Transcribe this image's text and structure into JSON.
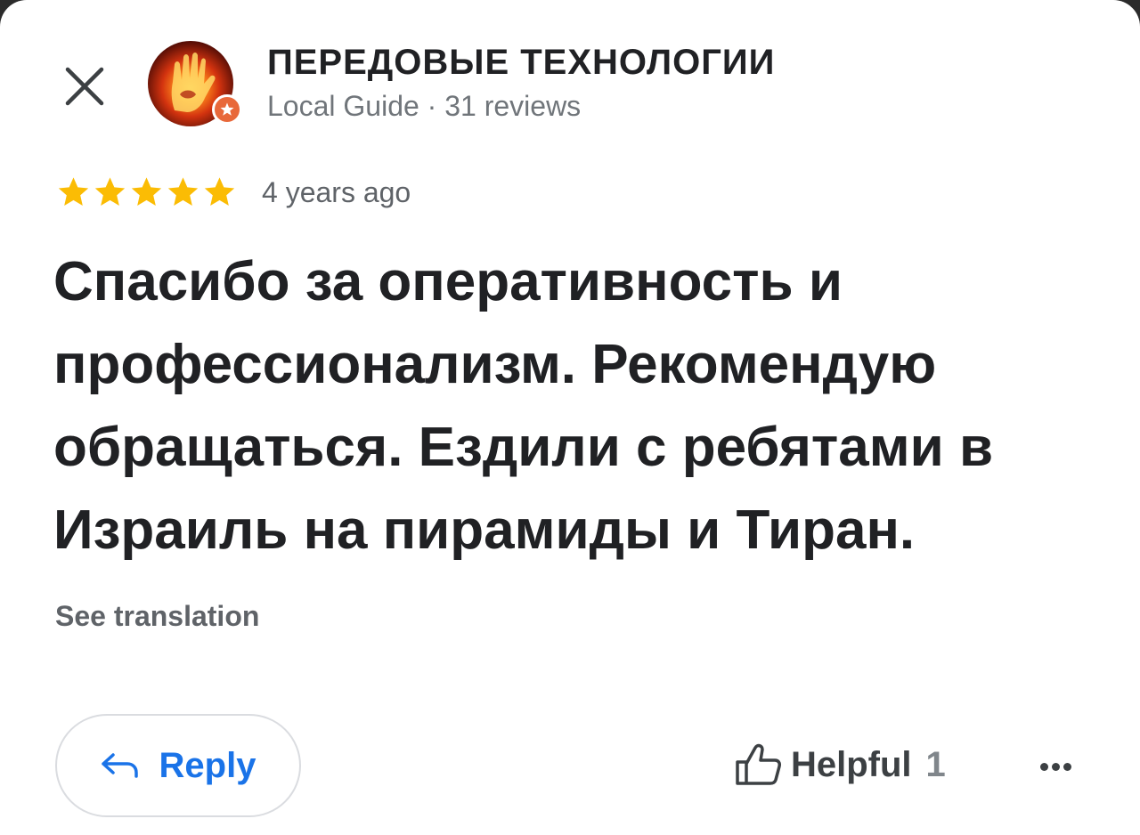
{
  "reviewer": {
    "name": "ПЕРЕДОВЫЕ ТЕХНОЛОГИИ",
    "subtitle": "Local Guide · 31 reviews",
    "avatar_icon": "flaming-hand-avatar",
    "badge_icon": "local-guide-star-badge",
    "badge_color": "#e8683a"
  },
  "review": {
    "rating": 5,
    "max_rating": 5,
    "star_color": "#fbbc04",
    "date": "4 years ago",
    "text": "Спасибо за оперативность и профессионализм. Рекомендую обращаться. Ездили с ребятами в Израиль на пирамиды и Тиран.",
    "translate_label": "See translation"
  },
  "actions": {
    "reply_label": "Reply",
    "reply_icon": "reply-arrow-icon",
    "accent_color": "#1a73e8",
    "helpful_label": "Helpful",
    "helpful_count": "1",
    "helpful_icon": "thumbs-up-icon",
    "more_icon": "more-horizontal-icon"
  },
  "close_icon": "close-icon"
}
